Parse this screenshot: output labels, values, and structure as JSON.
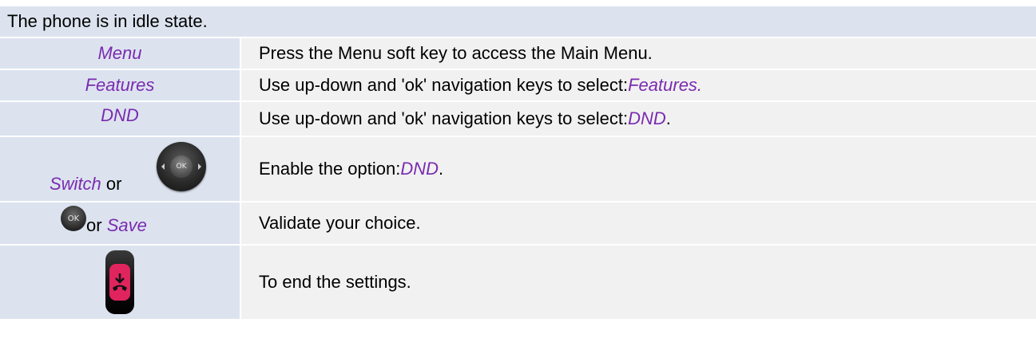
{
  "header": "The phone is in idle state.",
  "rows": [
    {
      "left": "Menu",
      "right": "Press the Menu soft key to access the Main Menu."
    },
    {
      "left": "Features",
      "right_prefix": "Use up-down and 'ok' navigation keys to select: ",
      "right_em": "Features."
    },
    {
      "left": "DND",
      "right_prefix": "Use up-down and 'ok' navigation keys to select: ",
      "right_em": "DND",
      "right_suffix": "."
    },
    {
      "left_em": "Switch",
      "left_plain": " or",
      "nav_ok_text": "OK",
      "right_prefix": "Enable the option: ",
      "right_em": "DND",
      "right_suffix": "."
    },
    {
      "ok_text": "OK",
      "left_plain": "or ",
      "left_em": "Save",
      "right": "Validate your choice."
    },
    {
      "right": "To end the settings."
    }
  ],
  "colors": {
    "accent_text": "#7a2bb0",
    "header_bg": "#dce3ef",
    "cell_bg": "#f1f1f1"
  },
  "icons": [
    "navigation-key-icon",
    "ok-key-icon",
    "end-call-key-icon"
  ]
}
